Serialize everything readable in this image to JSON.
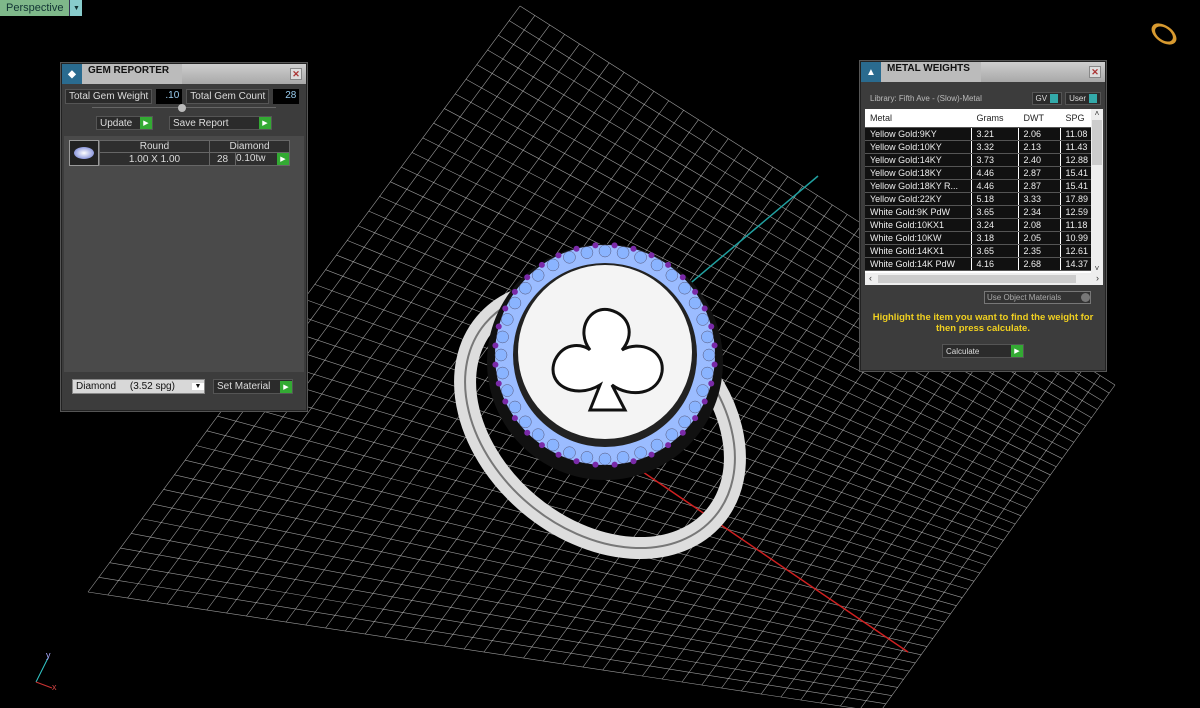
{
  "viewport": {
    "mode": "Perspective",
    "axes": {
      "x": "x",
      "y": "y"
    }
  },
  "gem_reporter": {
    "title": "GEM REPORTER",
    "total_weight_label": "Total Gem Weight",
    "total_weight": ".10",
    "total_count_label": "Total Gem Count",
    "total_count": "28",
    "update_label": "Update",
    "save_report_label": "Save Report",
    "gems": [
      {
        "shape": "Round",
        "material": "Diamond",
        "size": "1.00 X 1.00",
        "count": "28",
        "weight": "0.10tw"
      }
    ],
    "material_select": "Diamond     (3.52 spg)",
    "set_material_label": "Set Material"
  },
  "metal_weights": {
    "title": "METAL WEIGHTS",
    "library": "Library: Fifth Ave - (Slow)-Metal",
    "toggle_gv": "GV",
    "toggle_user": "User",
    "columns": [
      "Metal",
      "Grams",
      "DWT",
      "SPG"
    ],
    "rows": [
      [
        "Yellow Gold:9KY",
        "3.21",
        "2.06",
        "11.08"
      ],
      [
        "Yellow Gold:10KY",
        "3.32",
        "2.13",
        "11.43"
      ],
      [
        "Yellow Gold:14KY",
        "3.73",
        "2.40",
        "12.88"
      ],
      [
        "Yellow Gold:18KY",
        "4.46",
        "2.87",
        "15.41"
      ],
      [
        "Yellow Gold:18KY R...",
        "4.46",
        "2.87",
        "15.41"
      ],
      [
        "Yellow Gold:22KY",
        "5.18",
        "3.33",
        "17.89"
      ],
      [
        "White Gold:9K PdW",
        "3.65",
        "2.34",
        "12.59"
      ],
      [
        "White Gold:10KX1",
        "3.24",
        "2.08",
        "11.18"
      ],
      [
        "White Gold:10KW",
        "3.18",
        "2.05",
        "10.99"
      ],
      [
        "White Gold:14KX1",
        "3.65",
        "2.35",
        "12.61"
      ],
      [
        "White Gold:14K PdW",
        "4.16",
        "2.68",
        "14.37"
      ]
    ],
    "materials_select": "Use Object Materials",
    "hint": "Highlight the item you want to find the weight for then press calculate.",
    "calculate_label": "Calculate"
  },
  "colors": {
    "grid": "#cfcfcf",
    "x_axis": "#d02020",
    "y_axis": "#20a0a0",
    "gem_blue": "#8ab4ff",
    "gem_purple": "#7a2aa8",
    "go_button": "#33aa33",
    "hint": "#f0d020"
  }
}
